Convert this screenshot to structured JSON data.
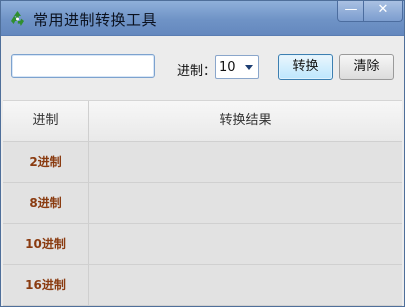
{
  "window": {
    "title": "常用进制转换工具",
    "minimize_glyph": "—",
    "close_glyph": "✕"
  },
  "toolbar": {
    "input_value": "",
    "base_label": "进制：",
    "base_value": "10",
    "convert_label": "转换",
    "clear_label": "清除"
  },
  "table": {
    "headers": {
      "base": "进制",
      "result": "转换结果"
    },
    "rows": [
      {
        "base": "2进制",
        "result": ""
      },
      {
        "base": "8进制",
        "result": ""
      },
      {
        "base": "10进制",
        "result": ""
      },
      {
        "base": "16进制",
        "result": ""
      }
    ]
  },
  "colors": {
    "accent": "#6f93c6",
    "row_label": "#8a3b10"
  }
}
